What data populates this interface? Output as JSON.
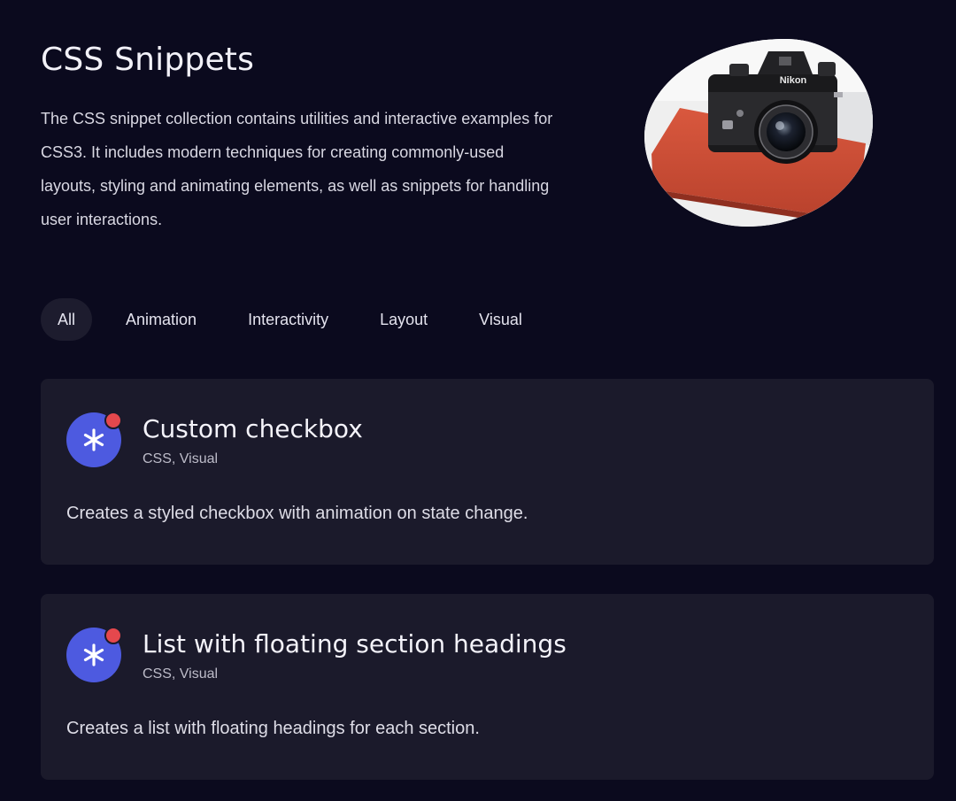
{
  "hero": {
    "title": "CSS Snippets",
    "description": "The CSS snippet collection contains utilities and interactive examples for CSS3. It includes modern techniques for creating commonly-used layouts, styling and animating elements, as well as snippets for handling user interactions.",
    "image_brand_text": "Nikon"
  },
  "filters": [
    {
      "label": "All",
      "active": true
    },
    {
      "label": "Animation",
      "active": false
    },
    {
      "label": "Interactivity",
      "active": false
    },
    {
      "label": "Layout",
      "active": false
    },
    {
      "label": "Visual",
      "active": false
    }
  ],
  "cards": [
    {
      "icon": "asterisk-icon",
      "title": "Custom checkbox",
      "tags": "CSS, Visual",
      "description": "Creates a styled checkbox with animation on state change."
    },
    {
      "icon": "asterisk-icon",
      "title": "List with floating section headings",
      "tags": "CSS, Visual",
      "description": "Creates a list with floating headings for each section."
    }
  ],
  "colors": {
    "background": "#0b0a1e",
    "card_background": "#1b1a2b",
    "active_tab_background": "#1d1c2e",
    "icon_blue": "#4d5ae0",
    "notification_red": "#e5484d"
  }
}
